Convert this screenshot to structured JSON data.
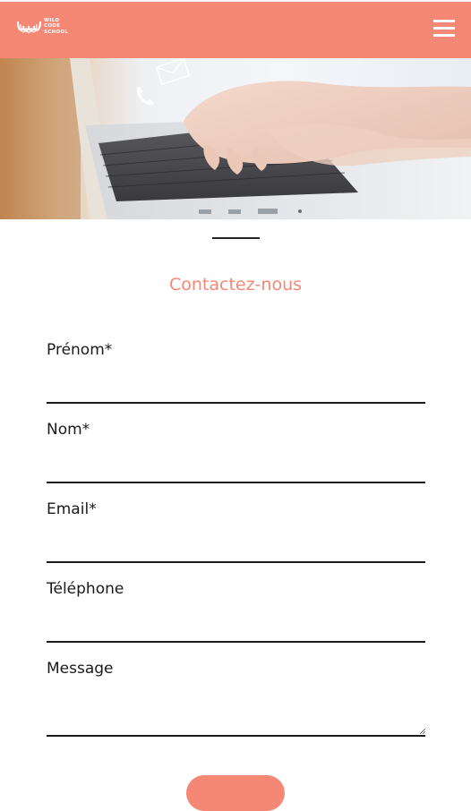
{
  "header": {
    "logo_text": [
      "WILD",
      "CODE",
      "SCHOOL"
    ],
    "menu_icon": "hamburger-menu-icon"
  },
  "hero": {
    "icons": [
      "phone-icon",
      "envelope-icon"
    ]
  },
  "contact": {
    "title": "Contactez-nous",
    "fields": [
      {
        "label": "Prénom*",
        "value": ""
      },
      {
        "label": "Nom*",
        "value": ""
      },
      {
        "label": "Email*",
        "value": ""
      },
      {
        "label": "Téléphone",
        "value": ""
      },
      {
        "label": "Message",
        "value": ""
      }
    ]
  },
  "colors": {
    "brand": "#f58775",
    "text": "#1a1a1a",
    "background": "#ffffff"
  }
}
